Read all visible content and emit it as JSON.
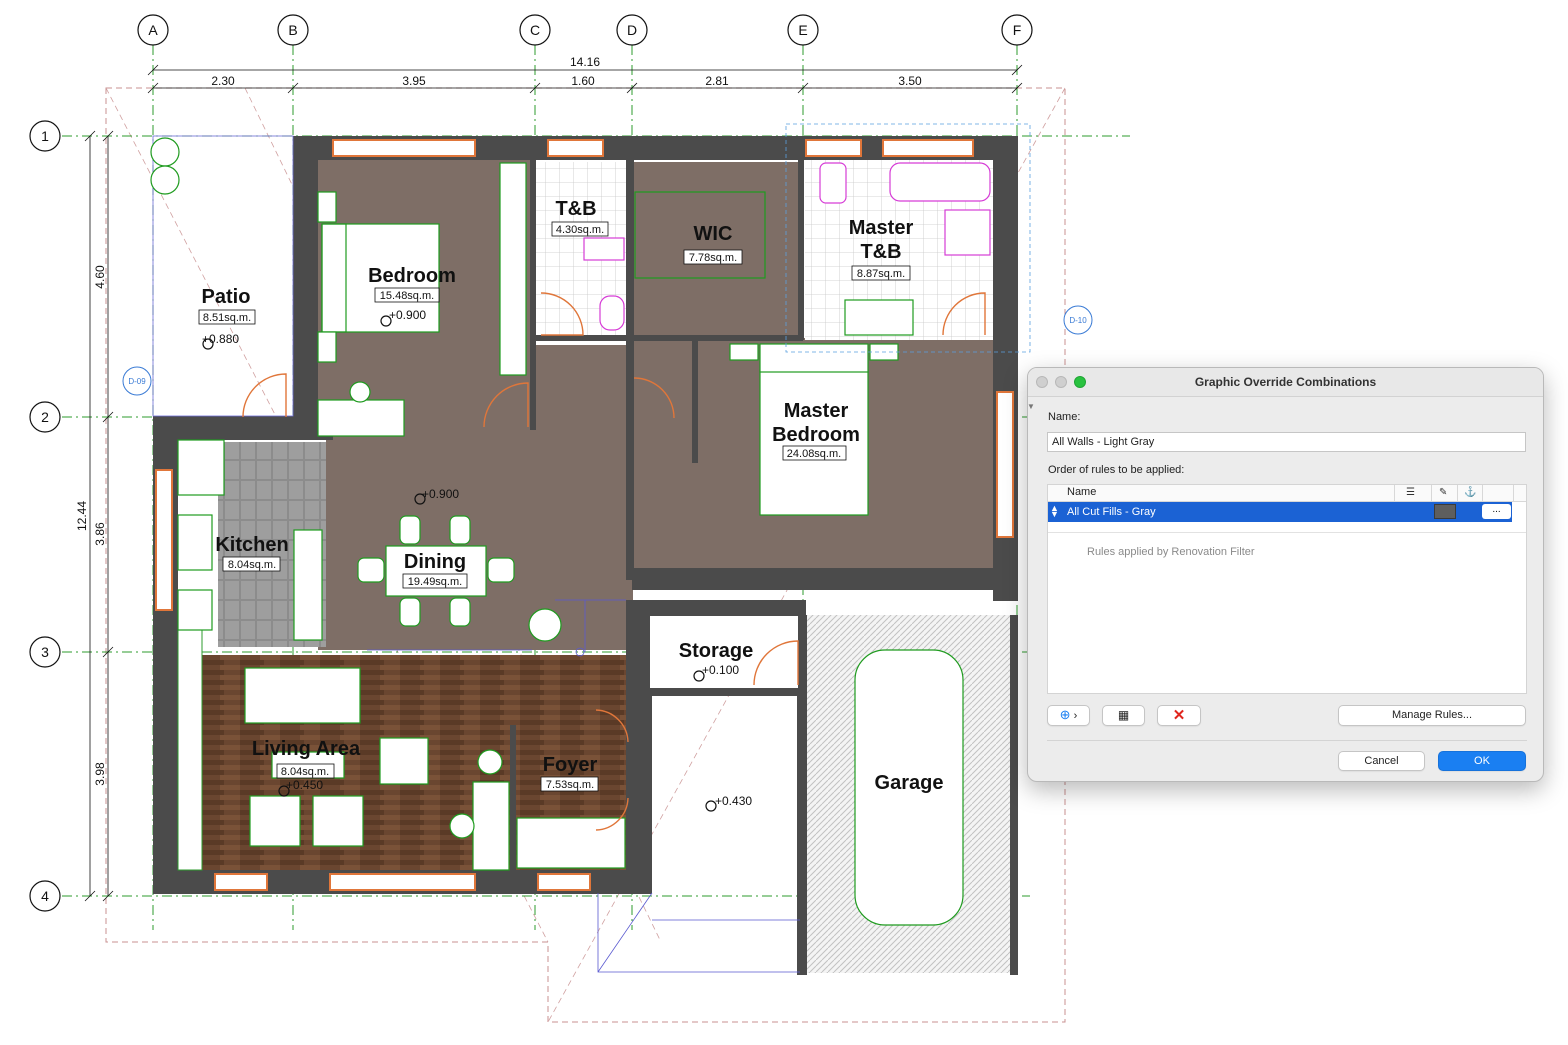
{
  "plan": {
    "grid_columns": [
      "A",
      "B",
      "C",
      "D",
      "E",
      "F"
    ],
    "grid_rows": [
      "1",
      "2",
      "3",
      "4"
    ],
    "dims_top_total": "14.16",
    "dims_top": [
      "2.30",
      "3.95",
      "1.60",
      "2.81",
      "3.50"
    ],
    "dims_left_total": "12.44",
    "dims_left": [
      "4.60",
      "3.86",
      "3.98"
    ],
    "tags": [
      "D-09",
      "D-10"
    ],
    "rooms": [
      {
        "name": "Patio",
        "area": "8.51sq.m.",
        "elev": "+0.880"
      },
      {
        "name": "Bedroom",
        "area": "15.48sq.m.",
        "elev": "+0.900"
      },
      {
        "name": "T&B",
        "area": "4.30sq.m."
      },
      {
        "name": "WIC",
        "area": "7.78sq.m."
      },
      {
        "name_line1": "Master",
        "name_line2": "T&B",
        "area": "8.87sq.m."
      },
      {
        "name_line1": "Master",
        "name_line2": "Bedroom",
        "area": "24.08sq.m."
      },
      {
        "name": "Kitchen",
        "area": "8.04sq.m."
      },
      {
        "name": "Dining",
        "area": "19.49sq.m.",
        "elev": "+0.900"
      },
      {
        "name": "Storage",
        "elev": "+0.100"
      },
      {
        "name": "Living Area",
        "area": "8.04sq.m.",
        "elev": "+0.450"
      },
      {
        "name": "Foyer",
        "area": "7.53sq.m."
      },
      {
        "name": "Garage",
        "elev": "+0.430"
      }
    ]
  },
  "dialog": {
    "title": "Graphic Override Combinations",
    "name_label": "Name:",
    "name_value": "All Walls - Light Gray",
    "order_label": "Order of rules to be applied:",
    "column_name": "Name",
    "rules": [
      {
        "name": "All Cut Fills - Gray",
        "swatch_color": "#5e5e5e",
        "more": "..."
      }
    ],
    "renovation_note": "Rules applied by Renovation Filter",
    "manage_button": "Manage Rules...",
    "cancel_button": "Cancel",
    "ok_button": "OK",
    "accent_color": "#1a7ff2",
    "selection_color": "#1b62d4",
    "icons": [
      "add-icon",
      "chevron-right-icon",
      "import-rule-icon",
      "delete-icon"
    ]
  }
}
